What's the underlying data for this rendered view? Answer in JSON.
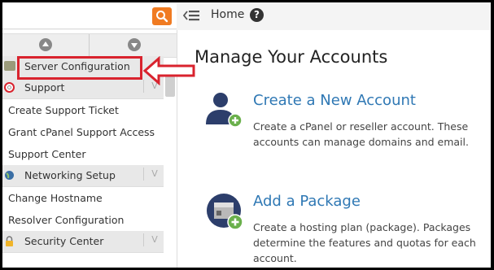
{
  "topbar": {
    "search_placeholder": "",
    "breadcrumb_home": "Home",
    "help_label": "?"
  },
  "sidebar": {
    "server_configuration": "Server Configuration",
    "support": {
      "label": "Support",
      "items": [
        "Create Support Ticket",
        "Grant cPanel Support Access",
        "Support Center"
      ]
    },
    "networking": {
      "label": "Networking Setup",
      "items": [
        "Change Hostname",
        "Resolver Configuration"
      ]
    },
    "security": {
      "label": "Security Center"
    },
    "chevron": "V"
  },
  "main": {
    "title": "Manage Your Accounts",
    "cards": [
      {
        "title": "Create a New Account",
        "description": "Create a cPanel or reseller account. These accounts can manage domains and email."
      },
      {
        "title": "Add a Package",
        "description": "Create a hosting plan (package). Packages determine the features and quotas for each account."
      }
    ]
  },
  "colors": {
    "accent_orange": "#f07b22",
    "link_blue": "#2f78b4",
    "highlight_red": "#d9232e",
    "badge_green": "#6ab04c"
  }
}
